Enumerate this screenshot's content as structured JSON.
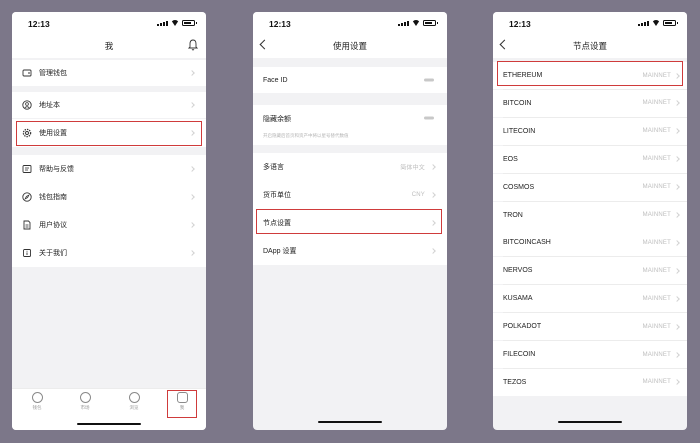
{
  "status_time": "12:13",
  "screen1": {
    "title": "我",
    "items": [
      {
        "label": "管理钱包",
        "icon": "wallet-icon"
      },
      {
        "label": "地址本",
        "icon": "contact-icon"
      },
      {
        "label": "使用设置",
        "icon": "gear-icon"
      },
      {
        "label": "帮助与反馈",
        "icon": "help-icon"
      },
      {
        "label": "钱包指南",
        "icon": "compass-icon"
      },
      {
        "label": "用户协议",
        "icon": "document-icon"
      },
      {
        "label": "关于我们",
        "icon": "info-icon"
      }
    ],
    "tabs": [
      {
        "label": "钱包",
        "icon": "wallet-tab-icon"
      },
      {
        "label": "市场",
        "icon": "market-tab-icon"
      },
      {
        "label": "浏览",
        "icon": "browser-tab-icon"
      },
      {
        "label": "我",
        "icon": "profile-tab-icon"
      }
    ]
  },
  "screen2": {
    "title": "使用设置",
    "face_id_label": "Face ID",
    "hide_balance_label": "隐藏余额",
    "hide_balance_hint": "开启隐藏后首页和资产中将以星号替代数值",
    "language_label": "多语言",
    "language_value": "简体中文",
    "currency_label": "货币单位",
    "currency_value": "CNY",
    "node_label": "节点设置",
    "dapp_label": "DApp 设置"
  },
  "screen3": {
    "title": "节点设置",
    "chains": [
      {
        "name": "ETHEREUM",
        "network": "MAINNET"
      },
      {
        "name": "BITCOIN",
        "network": "MAINNET"
      },
      {
        "name": "LITECOIN",
        "network": "MAINNET"
      },
      {
        "name": "EOS",
        "network": "MAINNET"
      },
      {
        "name": "COSMOS",
        "network": "MAINNET"
      },
      {
        "name": "TRON",
        "network": "MAINNET"
      },
      {
        "name": "BITCOINCASH",
        "network": "MAINNET"
      },
      {
        "name": "NERVOS",
        "network": "MAINNET"
      },
      {
        "name": "KUSAMA",
        "network": "MAINNET"
      },
      {
        "name": "POLKADOT",
        "network": "MAINNET"
      },
      {
        "name": "FILECOIN",
        "network": "MAINNET"
      },
      {
        "name": "TEZOS",
        "network": "MAINNET"
      }
    ]
  },
  "highlight_color": "#cf3b3b"
}
